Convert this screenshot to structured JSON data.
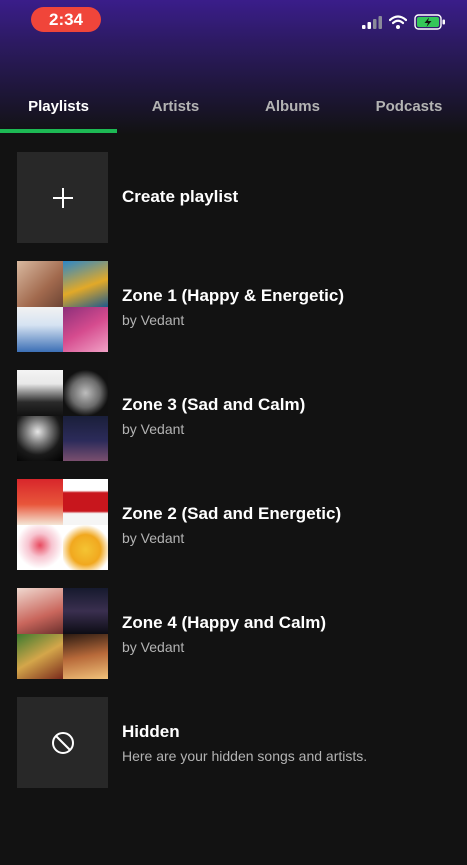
{
  "status_bar": {
    "time": "2:34",
    "icons": [
      "signal-icon",
      "wifi-icon",
      "battery-charging-icon"
    ]
  },
  "tabs": [
    {
      "label": "Playlists",
      "active": true
    },
    {
      "label": "Artists",
      "active": false
    },
    {
      "label": "Albums",
      "active": false
    },
    {
      "label": "Podcasts",
      "active": false
    }
  ],
  "create_playlist": {
    "label": "Create playlist",
    "icon": "plus-icon"
  },
  "playlists": [
    {
      "title": "Zone 1 (Happy & Energetic)",
      "owner": "by Vedant"
    },
    {
      "title": "Zone 3 (Sad and Calm)",
      "owner": "by Vedant"
    },
    {
      "title": "Zone 2 (Sad and Energetic)",
      "owner": "by Vedant"
    },
    {
      "title": "Zone 4 (Happy and Calm)",
      "owner": "by Vedant"
    }
  ],
  "hidden": {
    "title": "Hidden",
    "subtitle": "Here are your hidden songs and artists.",
    "icon": "blocked-icon"
  },
  "colors": {
    "accent": "#1db954",
    "background": "#121212",
    "time_pill": "#f0453a",
    "battery": "#34c759"
  }
}
